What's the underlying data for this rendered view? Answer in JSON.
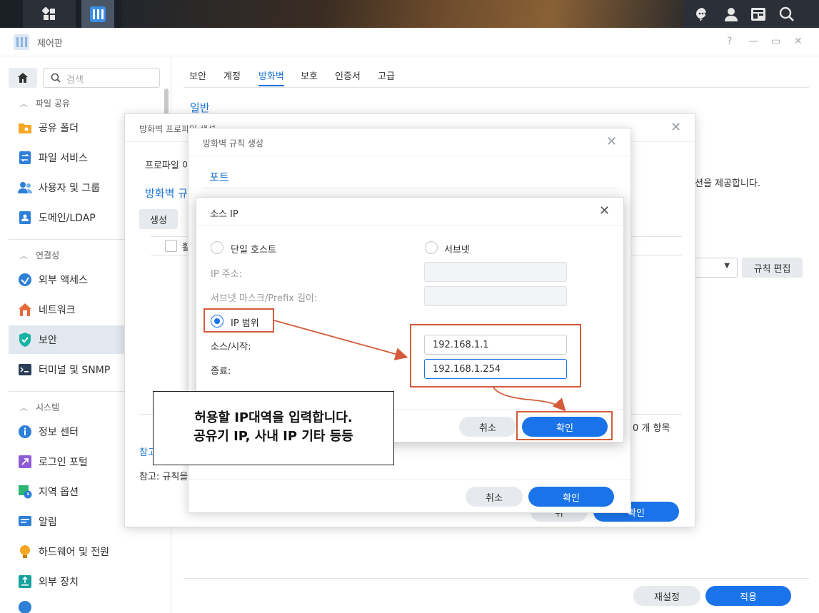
{
  "window": {
    "title": "제어판",
    "help": "?",
    "minimize": "—",
    "restore": "▭",
    "close": "✕"
  },
  "sidebar": {
    "search_placeholder": "검색",
    "sections": [
      {
        "label": "파일 공유",
        "items": [
          "공유 폴더",
          "파일 서비스",
          "사용자 및 그룹",
          "도메인/LDAP"
        ]
      },
      {
        "label": "연결성",
        "items": [
          "외부 액세스",
          "네트워크",
          "보안",
          "터미널 및 SNMP"
        ]
      },
      {
        "label": "시스템",
        "items": [
          "정보 센터",
          "로그인 포털",
          "지역 옵션",
          "알림",
          "하드웨어 및 전원",
          "외부 장치"
        ]
      }
    ],
    "active_item": "보안"
  },
  "main": {
    "tabs": [
      "보안",
      "계정",
      "방화벽",
      "보호",
      "인증서",
      "고급"
    ],
    "active_tab": "방화벽",
    "section_general": "일반",
    "bg_text_right": "션을 제공합니다.",
    "rule_edit_button": "규칙 편집",
    "reset_button": "재설정",
    "apply_button": "적용"
  },
  "profile_dialog": {
    "title": "방화벽 프로파일 생성",
    "profile_label": "프로파일 이",
    "rules_heading": "방화벽 규",
    "create_button": "생성",
    "enable_col": "활",
    "item_count": "0 개 항목",
    "note1": "참고",
    "note2": "참고: 규칙을",
    "cancel_button": "취",
    "ok_button": "확인"
  },
  "rule_dialog": {
    "title": "방화벽 규칙 생성",
    "port_heading": "포트",
    "cancel_button": "취소",
    "ok_button": "확인"
  },
  "source_ip_dialog": {
    "title": "소스 IP",
    "single_host_label": "단일 호스트",
    "subnet_label": "서브넷",
    "ip_address_label": "IP 주소:",
    "subnet_mask_label": "서브넷 마스크/Prefix 길이:",
    "ip_range_label": "IP 범위",
    "source_start_label": "소스/시작:",
    "end_label": "종료:",
    "start_value": "192.168.1.1",
    "end_value": "192.168.1.254",
    "cancel_button": "취소",
    "ok_button": "확인"
  },
  "annotation": {
    "line1": "허용할 IP대역을 입력합니다.",
    "line2": "공유기 IP, 사내 IP 기타 등등"
  },
  "colors": {
    "accent": "#1a73e8",
    "highlight": "#d45a3a",
    "taskbar": "#1b1f26"
  }
}
